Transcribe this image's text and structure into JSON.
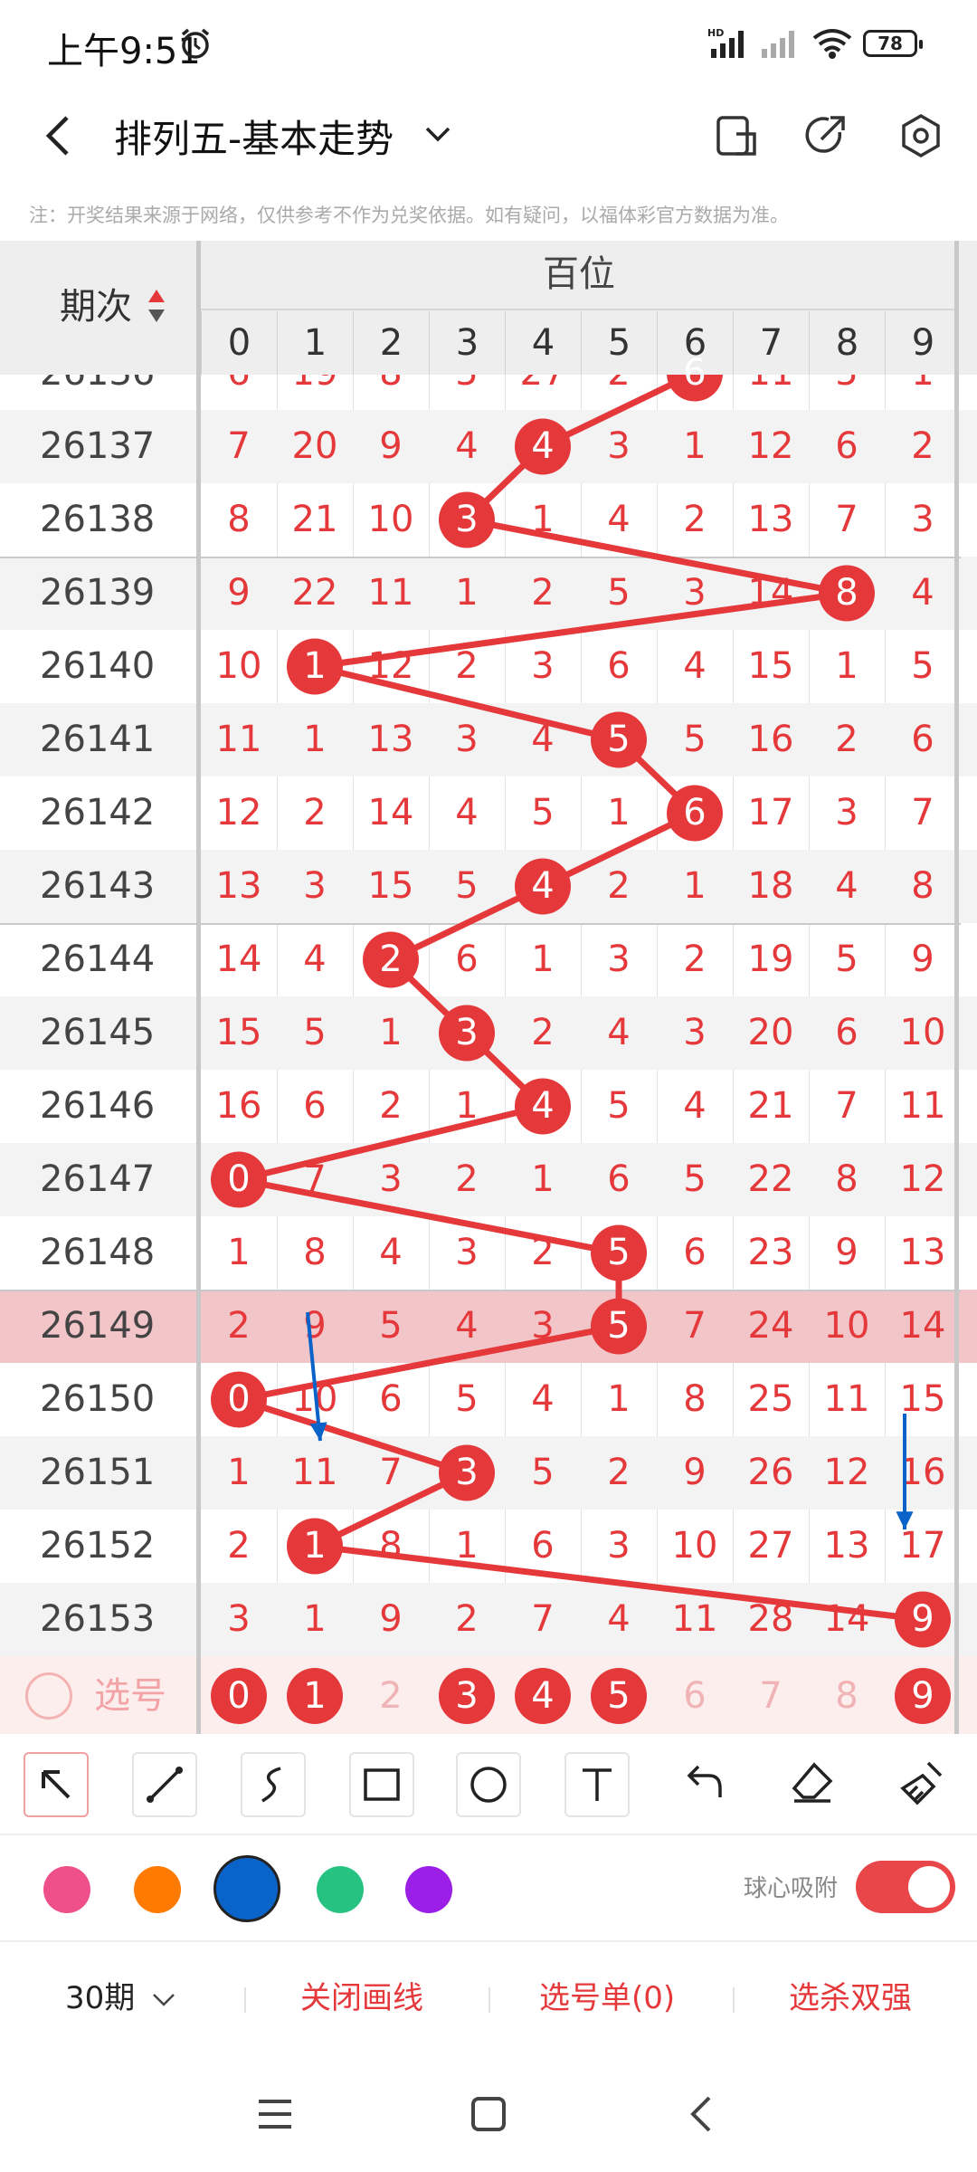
{
  "status": {
    "time": "上午9:51",
    "battery": "78",
    "hd": "HD"
  },
  "nav": {
    "title": "排列五-基本走势"
  },
  "note": "注：开奖结果来源于网络，仅供参考不作为兑奖依据。如有疑问，以福体彩官方数据为准。",
  "table": {
    "issue_header": "期次",
    "group_header": "百位",
    "digits": [
      "0",
      "1",
      "2",
      "3",
      "4",
      "5",
      "6",
      "7",
      "8",
      "9"
    ],
    "partial_row": {
      "issue": "26136",
      "cells": [
        "6",
        "19",
        "8",
        "5",
        "27",
        "2",
        "6",
        "11",
        "5",
        "1"
      ],
      "hit": 6
    },
    "rows": [
      {
        "issue": "26137",
        "cells": [
          "7",
          "20",
          "9",
          "4",
          "4",
          "3",
          "1",
          "12",
          "6",
          "2"
        ],
        "hit": 4
      },
      {
        "issue": "26138",
        "cells": [
          "8",
          "21",
          "10",
          "3",
          "1",
          "4",
          "2",
          "13",
          "7",
          "3"
        ],
        "hit": 3
      },
      {
        "issue": "26139",
        "cells": [
          "9",
          "22",
          "11",
          "1",
          "2",
          "5",
          "3",
          "14",
          "8",
          "4"
        ],
        "hit": 8
      },
      {
        "issue": "26140",
        "cells": [
          "10",
          "1",
          "12",
          "2",
          "3",
          "6",
          "4",
          "15",
          "1",
          "5"
        ],
        "hit": 1
      },
      {
        "issue": "26141",
        "cells": [
          "11",
          "1",
          "13",
          "3",
          "4",
          "5",
          "5",
          "16",
          "2",
          "6"
        ],
        "hit": 5
      },
      {
        "issue": "26142",
        "cells": [
          "12",
          "2",
          "14",
          "4",
          "5",
          "1",
          "6",
          "17",
          "3",
          "7"
        ],
        "hit": 6
      },
      {
        "issue": "26143",
        "cells": [
          "13",
          "3",
          "15",
          "5",
          "4",
          "2",
          "1",
          "18",
          "4",
          "8"
        ],
        "hit": 4
      },
      {
        "issue": "26144",
        "cells": [
          "14",
          "4",
          "2",
          "6",
          "1",
          "3",
          "2",
          "19",
          "5",
          "9"
        ],
        "hit": 2
      },
      {
        "issue": "26145",
        "cells": [
          "15",
          "5",
          "1",
          "3",
          "2",
          "4",
          "3",
          "20",
          "6",
          "10"
        ],
        "hit": 3
      },
      {
        "issue": "26146",
        "cells": [
          "16",
          "6",
          "2",
          "1",
          "4",
          "5",
          "4",
          "21",
          "7",
          "11"
        ],
        "hit": 4
      },
      {
        "issue": "26147",
        "cells": [
          "0",
          "7",
          "3",
          "2",
          "1",
          "6",
          "5",
          "22",
          "8",
          "12"
        ],
        "hit": 0
      },
      {
        "issue": "26148",
        "cells": [
          "1",
          "8",
          "4",
          "3",
          "2",
          "5",
          "6",
          "23",
          "9",
          "13"
        ],
        "hit": 5
      },
      {
        "issue": "26149",
        "cells": [
          "2",
          "9",
          "5",
          "4",
          "3",
          "5",
          "7",
          "24",
          "10",
          "14"
        ],
        "hit": 5
      },
      {
        "issue": "26150",
        "cells": [
          "0",
          "10",
          "6",
          "5",
          "4",
          "1",
          "8",
          "25",
          "11",
          "15"
        ],
        "hit": 0
      },
      {
        "issue": "26151",
        "cells": [
          "1",
          "11",
          "7",
          "3",
          "5",
          "2",
          "9",
          "26",
          "12",
          "16"
        ],
        "hit": 3
      },
      {
        "issue": "26152",
        "cells": [
          "2",
          "1",
          "8",
          "1",
          "6",
          "3",
          "10",
          "27",
          "13",
          "17"
        ],
        "hit": 1
      },
      {
        "issue": "26153",
        "cells": [
          "3",
          "1",
          "9",
          "2",
          "7",
          "4",
          "11",
          "28",
          "14",
          "9"
        ],
        "hit": 9
      }
    ],
    "pick_label": "选号",
    "pick": [
      {
        "d": "0",
        "on": true
      },
      {
        "d": "1",
        "on": true
      },
      {
        "d": "2",
        "on": false
      },
      {
        "d": "3",
        "on": true
      },
      {
        "d": "4",
        "on": true
      },
      {
        "d": "5",
        "on": true
      },
      {
        "d": "6",
        "on": false
      },
      {
        "d": "7",
        "on": false
      },
      {
        "d": "8",
        "on": false
      },
      {
        "d": "9",
        "on": true
      }
    ]
  },
  "tools": [
    "select-arrow",
    "line",
    "freehand",
    "rectangle",
    "circle",
    "text",
    "undo",
    "eraser",
    "clear-brush"
  ],
  "colors": [
    "#f0508a",
    "#ff7a00",
    "#0a63c9",
    "#26c281",
    "#9b1fe6"
  ],
  "selected_color": "#0a63c9",
  "snap_label": "球心吸附",
  "bottom": {
    "periods": "30期",
    "close_lines": "关闭画线",
    "pick_list": "选号单(0)",
    "kill": "选杀双强"
  },
  "accent": "#e5383b"
}
